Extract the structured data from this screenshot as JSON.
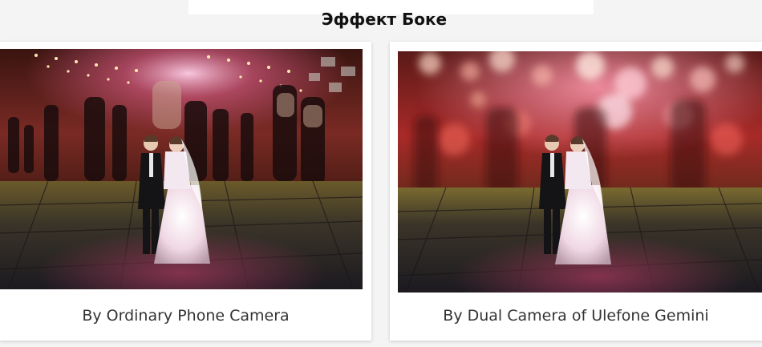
{
  "heading": "Эффект Боке",
  "cards": [
    {
      "caption": "By Ordinary Phone Camera",
      "image": "wedding-figurine-sharp-background"
    },
    {
      "caption": "By Dual Camera of Ulefone Gemini",
      "image": "wedding-figurine-bokeh-background"
    }
  ],
  "colors": {
    "background": "#f4f4f4",
    "card": "#ffffff",
    "heading": "#111111",
    "caption": "#333333"
  }
}
